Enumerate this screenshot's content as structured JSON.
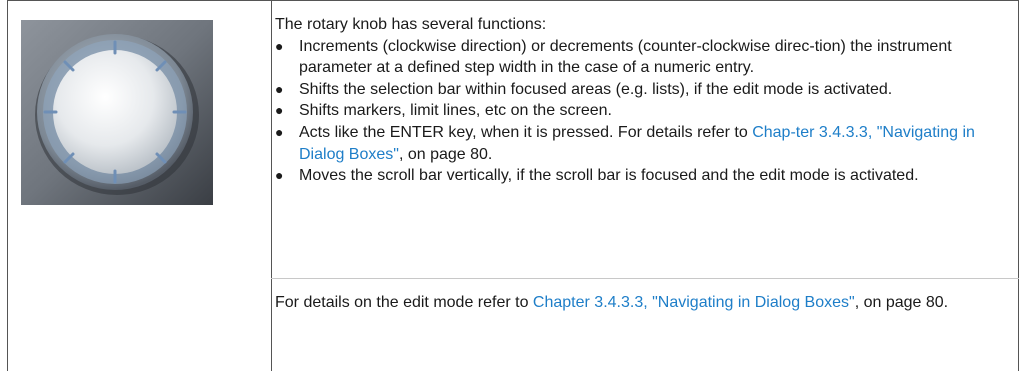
{
  "intro": "The rotary knob has several functions:",
  "bullets": [
    "Increments (clockwise direction) or decrements (counter-clockwise direc-­tion) the instrument parameter at a defined step width in the case of a numeric entry.",
    "Shifts the selection bar within focused areas (e.g. lists), if the edit mode is activated.",
    "Shifts markers, limit lines, etc on the screen.",
    "Moves the scroll bar vertically, if the scroll bar is focused and the edit mode is activated."
  ],
  "bullet4": {
    "pre": "Acts like the ENTER key, when it is pressed. For details refer to ",
    "link": "Chap-­ter 3.4.3.3, \"Navigating in Dialog Boxes\"",
    "post": ", on page 80."
  },
  "footer": {
    "pre": "For details on the edit mode refer to ",
    "link": "Chapter 3.4.3.3, \"Navigating in Dialog Boxes\"",
    "post": ", on page 80."
  },
  "colors": {
    "link": "#1e7ec8",
    "border": "#555555"
  },
  "image": {
    "icon": "rotary-knob-icon"
  }
}
